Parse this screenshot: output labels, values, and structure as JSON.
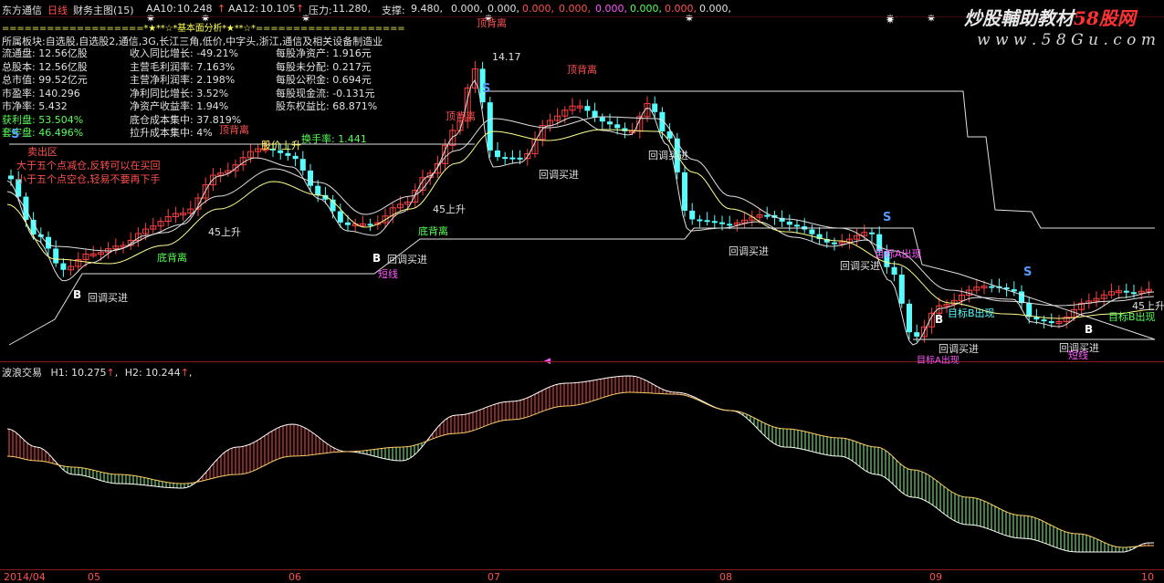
{
  "header": {
    "stock": "东方通信",
    "period": "日线",
    "indicator": "财务主图(15)",
    "aa10_label": "AA10:",
    "aa10_value": "10.248",
    "aa12_label": "AA12:",
    "aa12_value": "10.105",
    "pressure_label": "压力:",
    "pressure_value": "11.280,",
    "support_label": "支撑:",
    "support_values": [
      "9.480,",
      "0.000,",
      "0.000,",
      "0.000,",
      "0.000,",
      "0.000,",
      "0.000,",
      "0.000,",
      "0.000,"
    ],
    "up_arrow": "↑"
  },
  "watermark": {
    "title_a": "炒股輔助教材",
    "title_b": "58股网",
    "url": "w w w . 5 8 G u . c o m"
  },
  "fundamentals": {
    "banner": "===================*★**☆*基本面分析*★**☆*====================",
    "sector": "所属板块:自选股,自选股2,通信,3G,长江三角,低价,中字头,浙江,通信及相关设备制造业",
    "col1": [
      "流通盘: 12.56亿股",
      "总股本: 12.56亿股",
      "总市值: 99.52亿元",
      "市盈率: 140.296",
      "市净率: 5.432",
      "获利盘: 53.504%",
      "套牢盘: 46.496%"
    ],
    "col2": [
      "收入同比增长: -49.21%",
      "主营毛利润率: 7.163%",
      "主营净利润率: 2.198%",
      "净利同比增长: 3.52%",
      "净资产收益率: 1.94%",
      "底仓成本集中: 37.819%",
      "拉升成本集中: 4%"
    ],
    "col3": [
      "每股净资产: 1.916元",
      "每股未分配: 0.217元",
      "每股公积金: 0.694元",
      "每股现金流: -0.131元",
      "股东权益比: 68.871%"
    ],
    "turnover": "换手率: 1.441",
    "advice_1": "大于五个点减仓,反转可以在买回",
    "advice_2": "小于五个点空仓,轻易不要再下手",
    "mark_sell_zone": "卖出区",
    "mark_top_fast": "顶背离"
  },
  "annotations": {
    "price_high": "14.17",
    "top_div_1": "顶背离",
    "top_div_2": "顶背离",
    "top_div_3": "顶背离",
    "bottom_div_1": "底背离",
    "bottom_div_2": "底背离",
    "pullback_buy_1": "回调买进",
    "pullback_buy_2": "回调买进",
    "pullback_buy_3": "回调买进",
    "pullback_buy_4": "回调买进",
    "pullback_buy_5": "回调买进",
    "pullback_buy_6": "回调买进",
    "pullback_buy_7": "回调买进",
    "pullback_buy_8": "回调买进",
    "rise_45_1": "45上升",
    "rise_45_2": "45上升",
    "rise_45_3": "45上升",
    "short_line_1": "短线",
    "short_line_2": "短线",
    "target_1": "目标B出现",
    "target_2": "目标A出现",
    "target_3": "目标A出现",
    "target_4": "目标B出现",
    "stock_rise": "股价上升",
    "tip_above": "顶背离",
    "signal_s": "S",
    "signal_b": "B"
  },
  "indicator_panel": {
    "name": "波浪交易",
    "h1_label": "H1:",
    "h1_value": "10.275",
    "h2_label": "H2:",
    "h2_value": "10.244",
    "arrow": "↑"
  },
  "xaxis": {
    "labels": [
      "2014/04",
      "05",
      "06",
      "07",
      "08",
      "09",
      "10"
    ]
  },
  "colors": {
    "background": "#000000",
    "up_candle": "#ff4040",
    "down_candle": "#55ffff",
    "frame": "#8a1a1a",
    "text_yellow": "#ffff55",
    "text_red": "#ff5050",
    "text_cyan": "#55ffff",
    "text_magenta": "#ff55ff",
    "text_green": "#55ff55",
    "brand_red": "#ff3333"
  }
}
